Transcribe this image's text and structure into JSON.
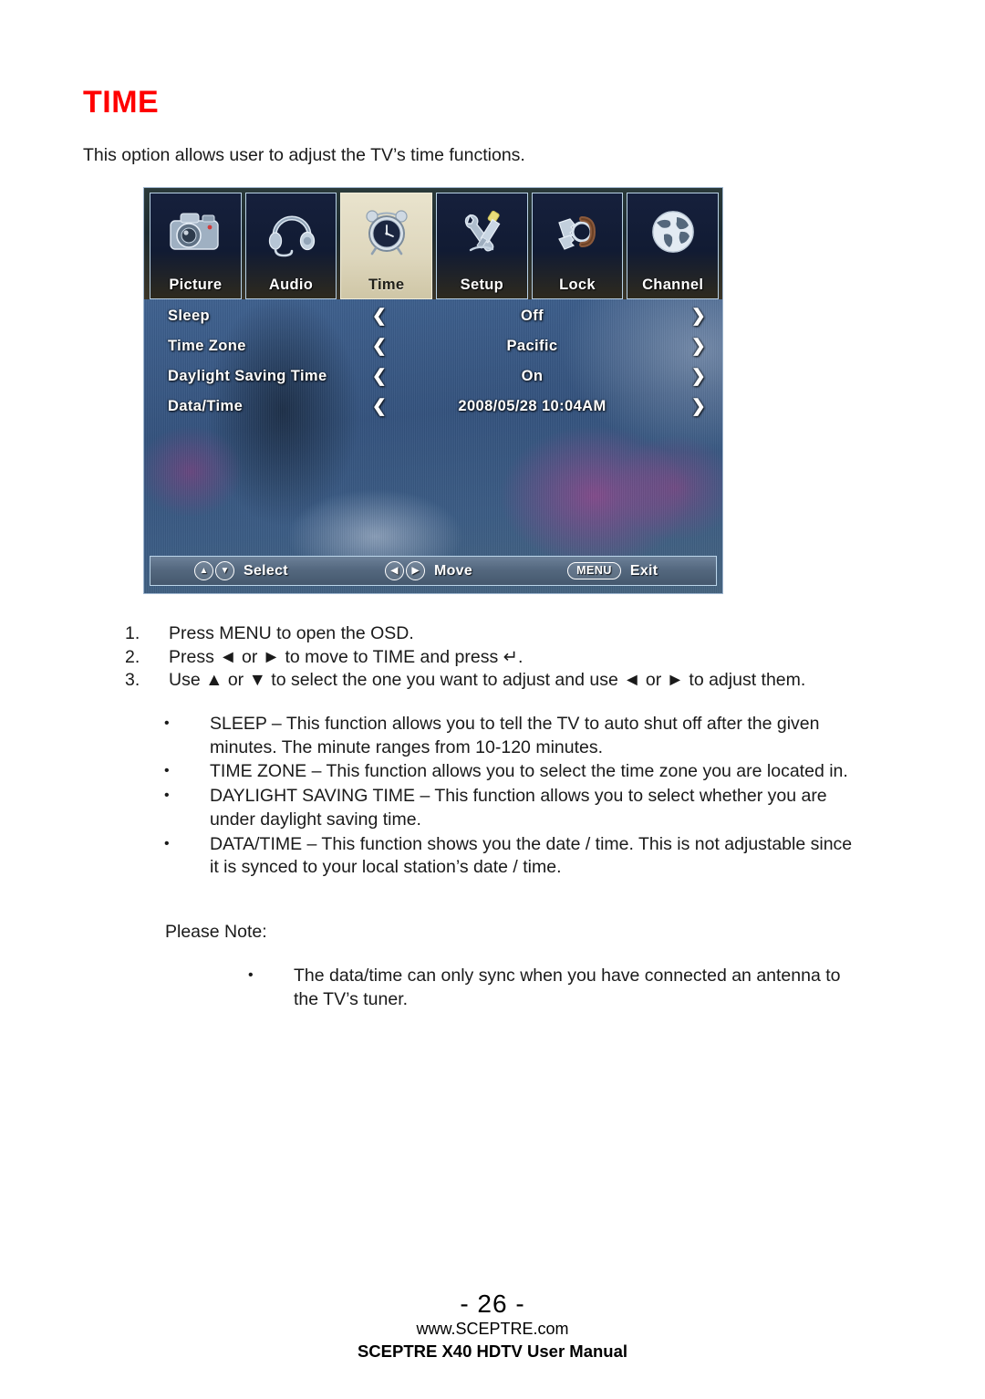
{
  "page_title": "TIME",
  "intro_paragraph": "This option allows user to adjust the TV’s time functions.",
  "osd": {
    "tabs": [
      {
        "label": "Picture",
        "icon": "camera-icon",
        "selected": false
      },
      {
        "label": "Audio",
        "icon": "headphones-icon",
        "selected": false
      },
      {
        "label": "Time",
        "icon": "alarm-clock-icon",
        "selected": true
      },
      {
        "label": "Setup",
        "icon": "wrench-screwdriver-icon",
        "selected": false
      },
      {
        "label": "Lock",
        "icon": "keys-icon",
        "selected": false
      },
      {
        "label": "Channel",
        "icon": "globe-icon",
        "selected": false
      }
    ],
    "rows": [
      {
        "label": "Sleep",
        "value": "Off",
        "left_arrow": "❮",
        "right_arrow": "❯"
      },
      {
        "label": "Time Zone",
        "value": "Pacific",
        "left_arrow": "❮",
        "right_arrow": "❯"
      },
      {
        "label": "Daylight Saving Time",
        "value": "On",
        "left_arrow": "❮",
        "right_arrow": "❯"
      },
      {
        "label": "Data/Time",
        "value": "2008/05/28 10:04AM",
        "left_arrow": "❮",
        "right_arrow": "❯"
      }
    ],
    "footer_hints": {
      "select_label": "Select",
      "select_up": "▲",
      "select_down": "▼",
      "move_label": "Move",
      "move_left": "◀",
      "move_right": "▶",
      "exit_key": "MENU",
      "exit_label": "Exit"
    },
    "highlight_color": "#e4ddc4",
    "tab_border_color": "#b9d2e6"
  },
  "steps": [
    {
      "num": "1.",
      "text": "Press MENU to open the OSD."
    },
    {
      "num": "2.",
      "text": "Press ◄ or ► to move to TIME and press ↵."
    },
    {
      "num": "3.",
      "text": "Use ▲ or ▼ to select the one you want to adjust and use ◄ or ► to adjust them."
    }
  ],
  "bullets_main": [
    {
      "dot": "•",
      "text": "SLEEP – This function allows you to tell the TV to auto shut off after the given minutes.  The minute ranges from 10-120 minutes."
    },
    {
      "dot": "•",
      "text": "TIME ZONE – This function allows you to select the time zone you are located in."
    },
    {
      "dot": "•",
      "text": "DAYLIGHT SAVING TIME – This function allows you to select whether you are under daylight saving time."
    },
    {
      "dot": "•",
      "text": "DATA/TIME – This function shows you the date / time.  This is not adjustable since it is synced to your local station’s date / time."
    }
  ],
  "please_note_label": "Please Note:",
  "bullets_note": [
    {
      "dot": "•",
      "text": "The data/time can only sync when you have connected an antenna to the TV’s tuner."
    }
  ],
  "footer": {
    "page_number": "- 26 -",
    "site": "www.SCEPTRE.com",
    "manual": "SCEPTRE X40 HDTV User Manual"
  }
}
